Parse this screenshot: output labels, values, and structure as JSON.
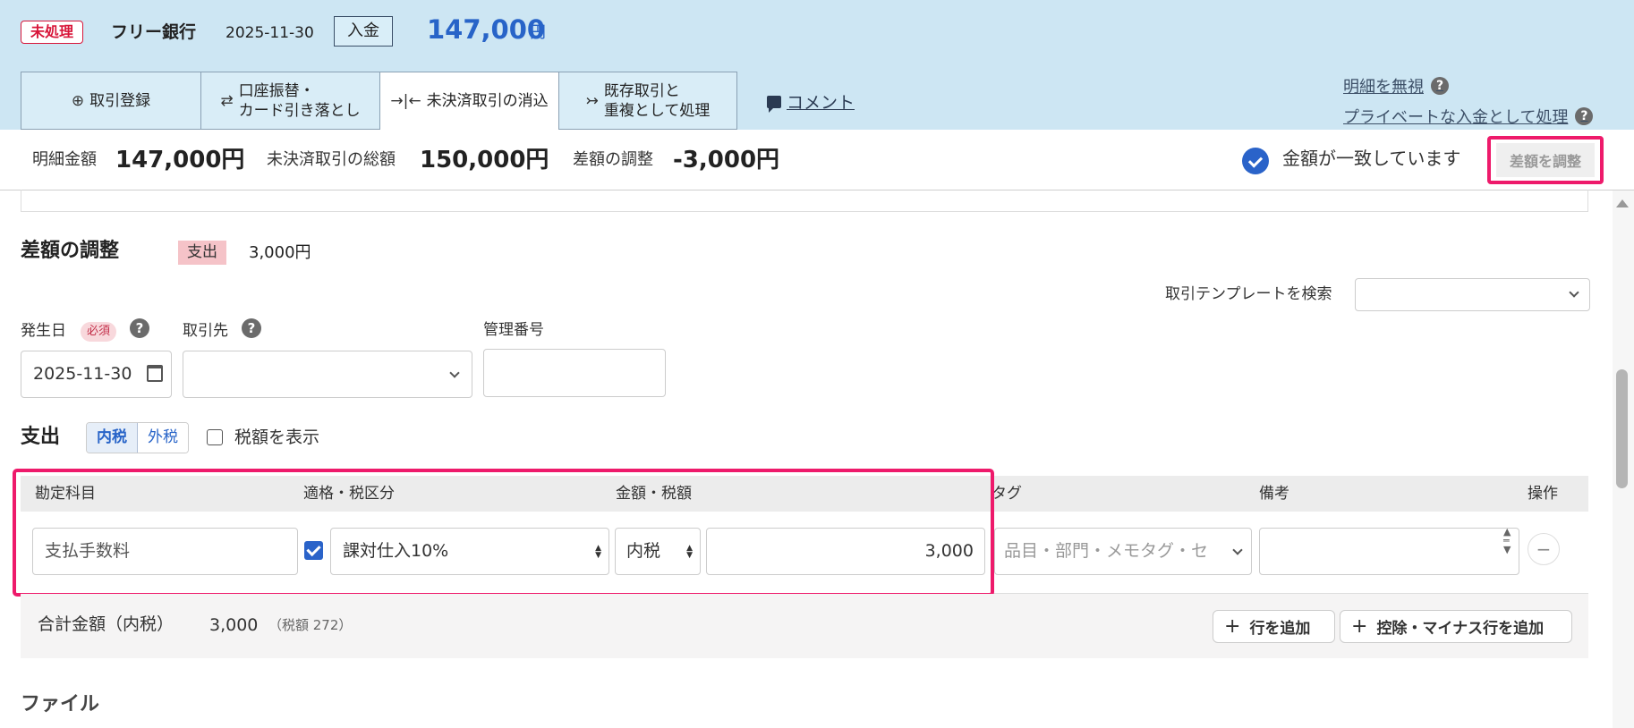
{
  "header": {
    "status": "未処理",
    "bank": "フリー銀行",
    "date": "2025-11-30",
    "type": "入金",
    "amount": "147,000",
    "unit": "円"
  },
  "tabs": [
    {
      "label": "取引登録",
      "icon": "plus-circle-icon"
    },
    {
      "label_line1": "口座振替・",
      "label_line2": "カード引き落とし",
      "icon": "swap-arrows-icon"
    },
    {
      "label": "未決済取引の消込",
      "icon": "merge-arrows-icon"
    },
    {
      "label_line1": "既存取引と",
      "label_line2": "重複として処理",
      "icon": "merge-right-icon"
    }
  ],
  "comment_link": "コメント",
  "right_links": {
    "ignore": "明細を無視",
    "private": "プライベートな入金として処理",
    "help": "?"
  },
  "summary": {
    "detail_label": "明細金額",
    "detail_value": "147,000円",
    "unsettled_label": "未決済取引の総額",
    "unsettled_value": "150,000円",
    "diff_label": "差額の調整",
    "diff_value": "-3,000円",
    "match_text": "金額が一致しています",
    "adjust_button": "差額を調整"
  },
  "section": {
    "title": "差額の調整",
    "badge": "支出",
    "amount": "3,000円",
    "template_label": "取引テンプレートを検索",
    "template_value": ""
  },
  "form": {
    "date_label": "発生日",
    "required": "必須",
    "date_value": "2025-11-30",
    "partner_label": "取引先",
    "partner_value": "",
    "mgmt_label": "管理番号",
    "mgmt_value": ""
  },
  "expense": {
    "title": "支出",
    "tax_included": "内税",
    "tax_excluded": "外税",
    "show_tax": "税額を表示"
  },
  "table": {
    "headers": {
      "account": "勘定科目",
      "tax_category": "適格・税区分",
      "amount": "金額・税額",
      "tag": "タグ",
      "memo": "備考",
      "action": "操作"
    },
    "row": {
      "account": "支払手数料",
      "tax_category": "課対仕入10%",
      "tax_mode": "内税",
      "amount": "3,000",
      "tag_placeholder": "品目・部門・メモタグ・セ",
      "memo": ""
    }
  },
  "total": {
    "label": "合計金額（内税）",
    "amount": "3,000",
    "tax": "（税額 272）",
    "add_row": "行を追加",
    "add_minus_row": "控除・マイナス行を追加"
  },
  "file_title": "ファイル",
  "colors": {
    "header_bg": "#cde6f3",
    "accent_blue": "#2864c8",
    "highlight_pink": "#ee1a6b",
    "status_red": "#d8163a"
  }
}
